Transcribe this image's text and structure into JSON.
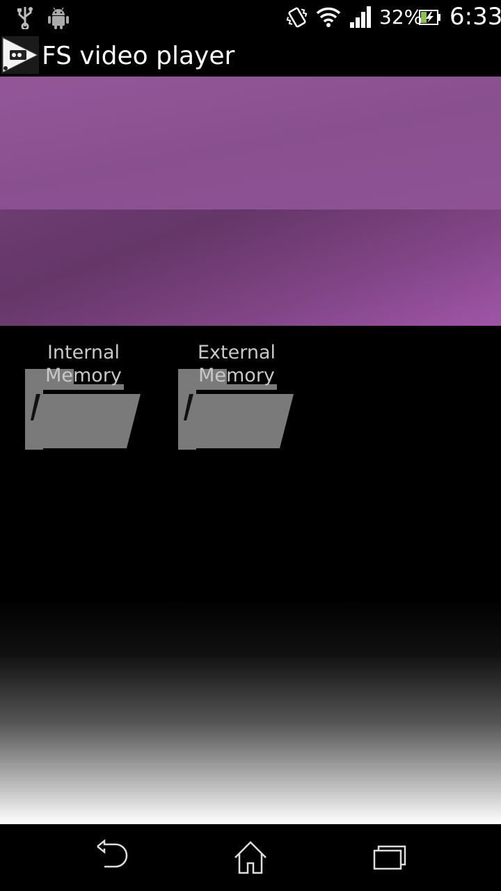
{
  "status_bar": {
    "icons": [
      "usb-icon",
      "android-debug-icon",
      "vibrate-icon",
      "wifi-icon",
      "signal-icon",
      "battery-icon"
    ],
    "battery_percent": "32%",
    "time": "6:33"
  },
  "action_bar": {
    "logo": "fs-video-player-logo-icon",
    "title": "FS video player"
  },
  "storage": [
    {
      "label": "Internal Memory",
      "icon": "folder-icon"
    },
    {
      "label": "External Memory",
      "icon": "folder-icon"
    }
  ],
  "nav_bar": {
    "buttons": [
      "back-icon",
      "home-icon",
      "recent-apps-icon"
    ]
  },
  "colors": {
    "banner": "#8a4c8f",
    "folder": "#7a7a7a",
    "label": "#c8c8c8"
  }
}
